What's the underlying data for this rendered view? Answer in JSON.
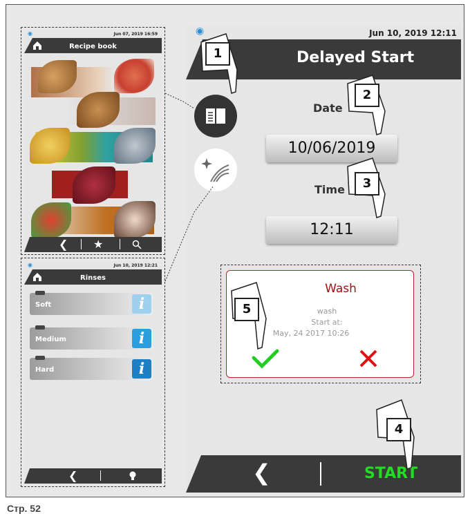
{
  "recipe_phone": {
    "status_date": "Jun 07, 2019 16:59",
    "title": "Recipe book"
  },
  "rinses_phone": {
    "status_date": "Jun 10, 2019 12:21",
    "title": "Rinses",
    "items": [
      {
        "label": "Soft",
        "info_color": "#9fd0ee"
      },
      {
        "label": "Medium",
        "info_color": "#2a9ee0"
      },
      {
        "label": "Hard",
        "info_color": "#1f7fc4"
      }
    ]
  },
  "main": {
    "status_date": "Jun 10, 2019  12:11",
    "title": "Delayed Start",
    "date_label": "Date",
    "date_value": "10/06/2019",
    "time_label": "Time",
    "time_value": "12:11",
    "start_label": "START",
    "start_color": "#22dd22"
  },
  "wash_card": {
    "title": "Wash",
    "program": "wash",
    "start_at_label": "Start at:",
    "start_at_value": "May, 24 2017  10:26",
    "confirm_color": "#22cc22",
    "cancel_color": "#dd1111"
  },
  "markers": [
    "1",
    "2",
    "3",
    "4",
    "5"
  ],
  "caption": "Стр. 52"
}
